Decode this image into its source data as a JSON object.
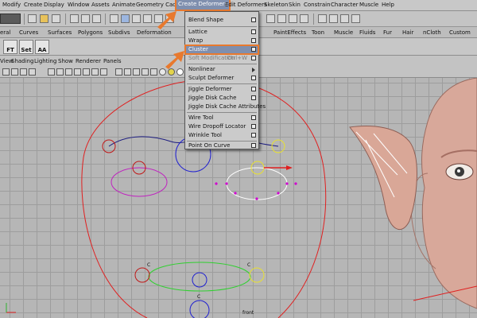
{
  "menubar": {
    "items": [
      {
        "label": "Modify"
      },
      {
        "label": "Create"
      },
      {
        "label": "Display"
      },
      {
        "label": "Window"
      },
      {
        "label": "Assets"
      },
      {
        "label": "Animate"
      },
      {
        "label": "Geometry Cache"
      },
      {
        "label": "Create Deformers"
      },
      {
        "label": "Edit Deformers"
      },
      {
        "label": "Skeleton"
      },
      {
        "label": "Skin"
      },
      {
        "label": "Constrain"
      },
      {
        "label": "Character"
      },
      {
        "label": "Muscle"
      },
      {
        "label": "Help"
      }
    ],
    "active": "Create Deformers"
  },
  "shelf_tabs": [
    "eral",
    "Curves",
    "Surfaces",
    "Polygons",
    "Subdivs",
    "Deformation",
    "PaintEffects",
    "Toon",
    "Muscle",
    "Fluids",
    "Fur",
    "Hair",
    "nCloth",
    "Custom"
  ],
  "shelf_buttons": [
    {
      "label": "FT"
    },
    {
      "label": "Set"
    },
    {
      "label": "AA"
    }
  ],
  "panel_menu": [
    "View",
    "Shading",
    "Lighting",
    "Show",
    "Renderer",
    "Panels"
  ],
  "dropdown": {
    "items": [
      {
        "label": "Blend Shape",
        "options": true
      },
      {
        "label": "Lattice",
        "options": true
      },
      {
        "label": "Wrap",
        "options": true
      },
      {
        "label": "Cluster",
        "options": true,
        "highlighted": true
      },
      {
        "label": "Soft Modification",
        "shortcut": "Ctrl+W",
        "options": true
      },
      {
        "label": "Nonlinear",
        "submenu": true
      },
      {
        "label": "Sculpt Deformer",
        "options": true
      },
      {
        "label": "Jiggle Deformer",
        "options": true
      },
      {
        "label": "Jiggle Disk Cache",
        "options": true
      },
      {
        "label": "Jiggle Disk Cache Attributes"
      },
      {
        "label": "Wire Tool",
        "options": true
      },
      {
        "label": "Wire Dropoff Locator",
        "options": true
      },
      {
        "label": "Wrinkle Tool",
        "options": true
      },
      {
        "label": "Point On Curve",
        "options": true
      }
    ]
  },
  "viewport": {
    "camera_label": "front",
    "cluster_labels": [
      "C",
      "C",
      "C"
    ]
  },
  "colors": {
    "highlight": "#7f8fae",
    "annotation": "#e8792e"
  }
}
